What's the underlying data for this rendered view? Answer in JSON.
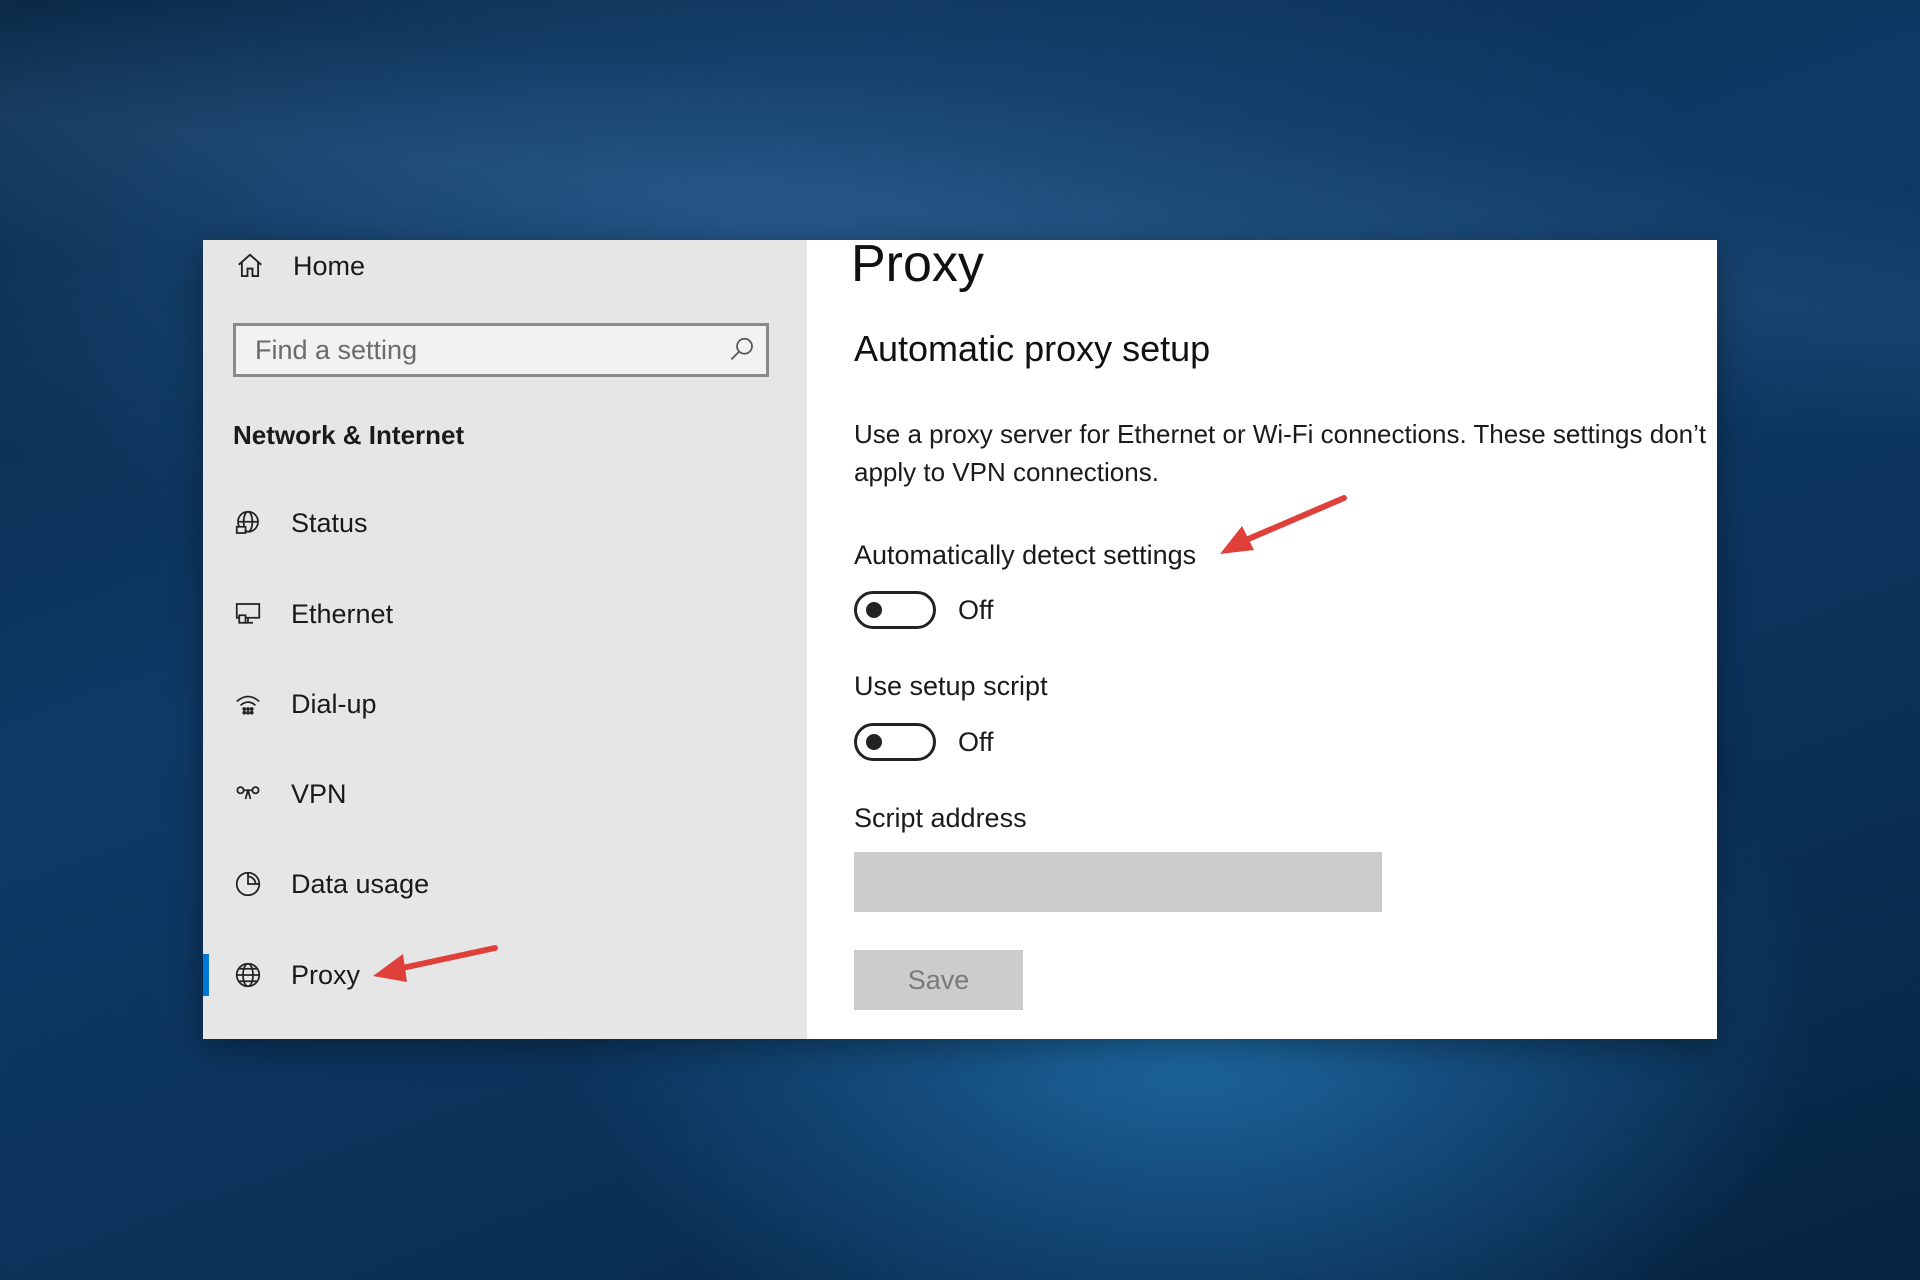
{
  "colors": {
    "accent": "#0078d7",
    "sidebar_bg": "#e6e6e6",
    "main_bg": "#ffffff",
    "annotation_arrow": "#e0403a",
    "disabled_control": "#cccccc"
  },
  "sidebar": {
    "home": {
      "label": "Home",
      "icon": "home-icon"
    },
    "search": {
      "placeholder": "Find a setting",
      "icon": "search-icon"
    },
    "section_title": "Network & Internet",
    "items": [
      {
        "label": "Status",
        "icon": "network-status-icon"
      },
      {
        "label": "Ethernet",
        "icon": "ethernet-icon"
      },
      {
        "label": "Dial-up",
        "icon": "dial-up-icon"
      },
      {
        "label": "VPN",
        "icon": "vpn-icon"
      },
      {
        "label": "Data usage",
        "icon": "data-usage-icon"
      },
      {
        "label": "Proxy",
        "icon": "globe-icon",
        "selected": true
      }
    ]
  },
  "main": {
    "title": "Proxy",
    "subtitle": "Automatic proxy setup",
    "description": "Use a proxy server for Ethernet or Wi-Fi connections. These settings don’t apply to VPN connections.",
    "auto_detect": {
      "label": "Automatically detect settings",
      "state": "Off"
    },
    "setup_script": {
      "label": "Use setup script",
      "state": "Off"
    },
    "script_address": {
      "label": "Script address",
      "value": ""
    },
    "save_label": "Save"
  }
}
